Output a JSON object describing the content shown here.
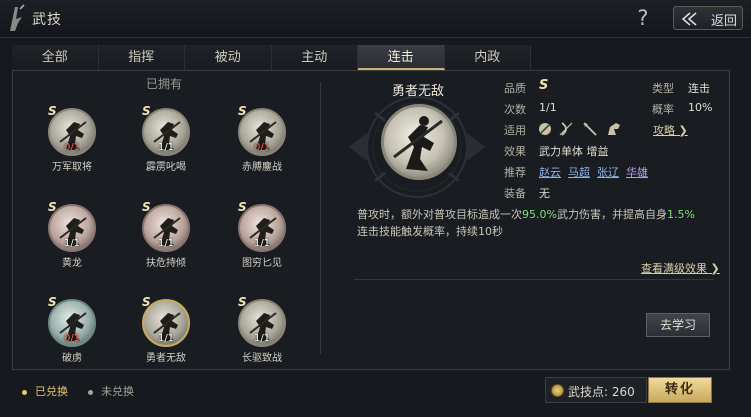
{
  "header": {
    "title": "武技",
    "help_icon": "?",
    "back_label": "返回"
  },
  "tabs": [
    {
      "label": "全部",
      "active": false
    },
    {
      "label": "指挥",
      "active": false
    },
    {
      "label": "被动",
      "active": false
    },
    {
      "label": "主动",
      "active": false
    },
    {
      "label": "连击",
      "active": true
    },
    {
      "label": "内政",
      "active": false
    }
  ],
  "left": {
    "owned_label": "已拥有",
    "skills": [
      {
        "name": "万军取将",
        "grade": "S",
        "count": "0/1",
        "count_color": "red",
        "tone": "neutral"
      },
      {
        "name": "霹雳叱喝",
        "grade": "S",
        "count": "1/1",
        "count_color": "white",
        "tone": "neutral"
      },
      {
        "name": "赤膊鏖战",
        "grade": "S",
        "count": "0/1",
        "count_color": "red",
        "tone": "neutral"
      },
      {
        "name": "黄龙",
        "grade": "S",
        "count": "1/1",
        "count_color": "white",
        "tone": "red"
      },
      {
        "name": "扶危持倾",
        "grade": "S",
        "count": "1/1",
        "count_color": "white",
        "tone": "red"
      },
      {
        "name": "图穷匕见",
        "grade": "S",
        "count": "1/1",
        "count_color": "white",
        "tone": "red"
      },
      {
        "name": "破虏",
        "grade": "S",
        "count": "0/1",
        "count_color": "red",
        "tone": "teal"
      },
      {
        "name": "勇者无敌",
        "grade": "S",
        "count": "1/1",
        "count_color": "white",
        "tone": "gold"
      },
      {
        "name": "长驱致战",
        "grade": "S",
        "count": "1/1",
        "count_color": "white",
        "tone": "neutral"
      }
    ]
  },
  "detail": {
    "name": "勇者无敌",
    "quality_label": "品质",
    "quality_value": "S",
    "type_label": "类型",
    "type_value": "连击",
    "count_label": "次数",
    "count_value": "1/1",
    "prob_label": "概率",
    "prob_value": "10%",
    "apply_label": "适用",
    "apply_icons": [
      "shield-icon",
      "bow-icon",
      "spear-icon",
      "horse-icon"
    ],
    "strategy_label": "攻略",
    "effect_label": "效果",
    "effect_value": "武力单体 增益",
    "recommend_label": "推荐",
    "recommend": [
      "赵云",
      "马超",
      "张辽",
      "华雄"
    ],
    "equip_label": "装备",
    "equip_value": "无",
    "desc_1": "普攻时，额外对普攻目标造成一次",
    "desc_pct_1": "95.0%",
    "desc_2": "武力伤害，并提高自身",
    "desc_pct_2": "1.5%",
    "desc_3": "连击技能触发概率，持续10秒",
    "view_full_label": "查看满级效果",
    "learn_label": "去学习"
  },
  "footer": {
    "legend_owned": "已兑换",
    "legend_unowned": "未兑换",
    "points_label": "武技点: 260",
    "convert_label": "转化"
  },
  "colors": {
    "accent_gold": "#c8a85c",
    "highlight_green": "#7ee07a",
    "count_red": "#ff6a5a",
    "link_blue": "#8fb4e8",
    "link_purple": "#b79ef0"
  }
}
